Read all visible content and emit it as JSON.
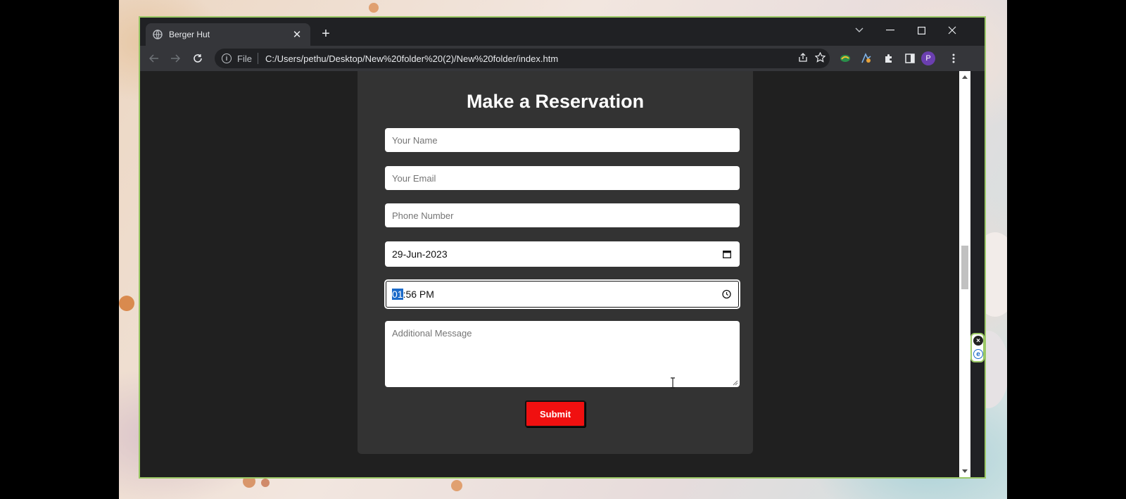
{
  "browser": {
    "tab_title": "Berger Hut",
    "tab_close": "✕",
    "new_tab": "+",
    "scheme_label": "File",
    "url": "C:/Users/pethu/Desktop/New%20folder%20(2)/New%20folder/index.htm",
    "profile_initial": "P"
  },
  "form": {
    "heading": "Make a Reservation",
    "name_placeholder": "Your Name",
    "email_placeholder": "Your Email",
    "phone_placeholder": "Phone Number",
    "date_value": "29-Jun-2023",
    "time_hour": "01",
    "time_rest": ":56  PM",
    "message_placeholder": "Additional Message",
    "submit_label": "Submit"
  },
  "colors": {
    "accent_submit": "#f01010",
    "window_border": "#9bc866",
    "selection": "#1b6ac9"
  }
}
